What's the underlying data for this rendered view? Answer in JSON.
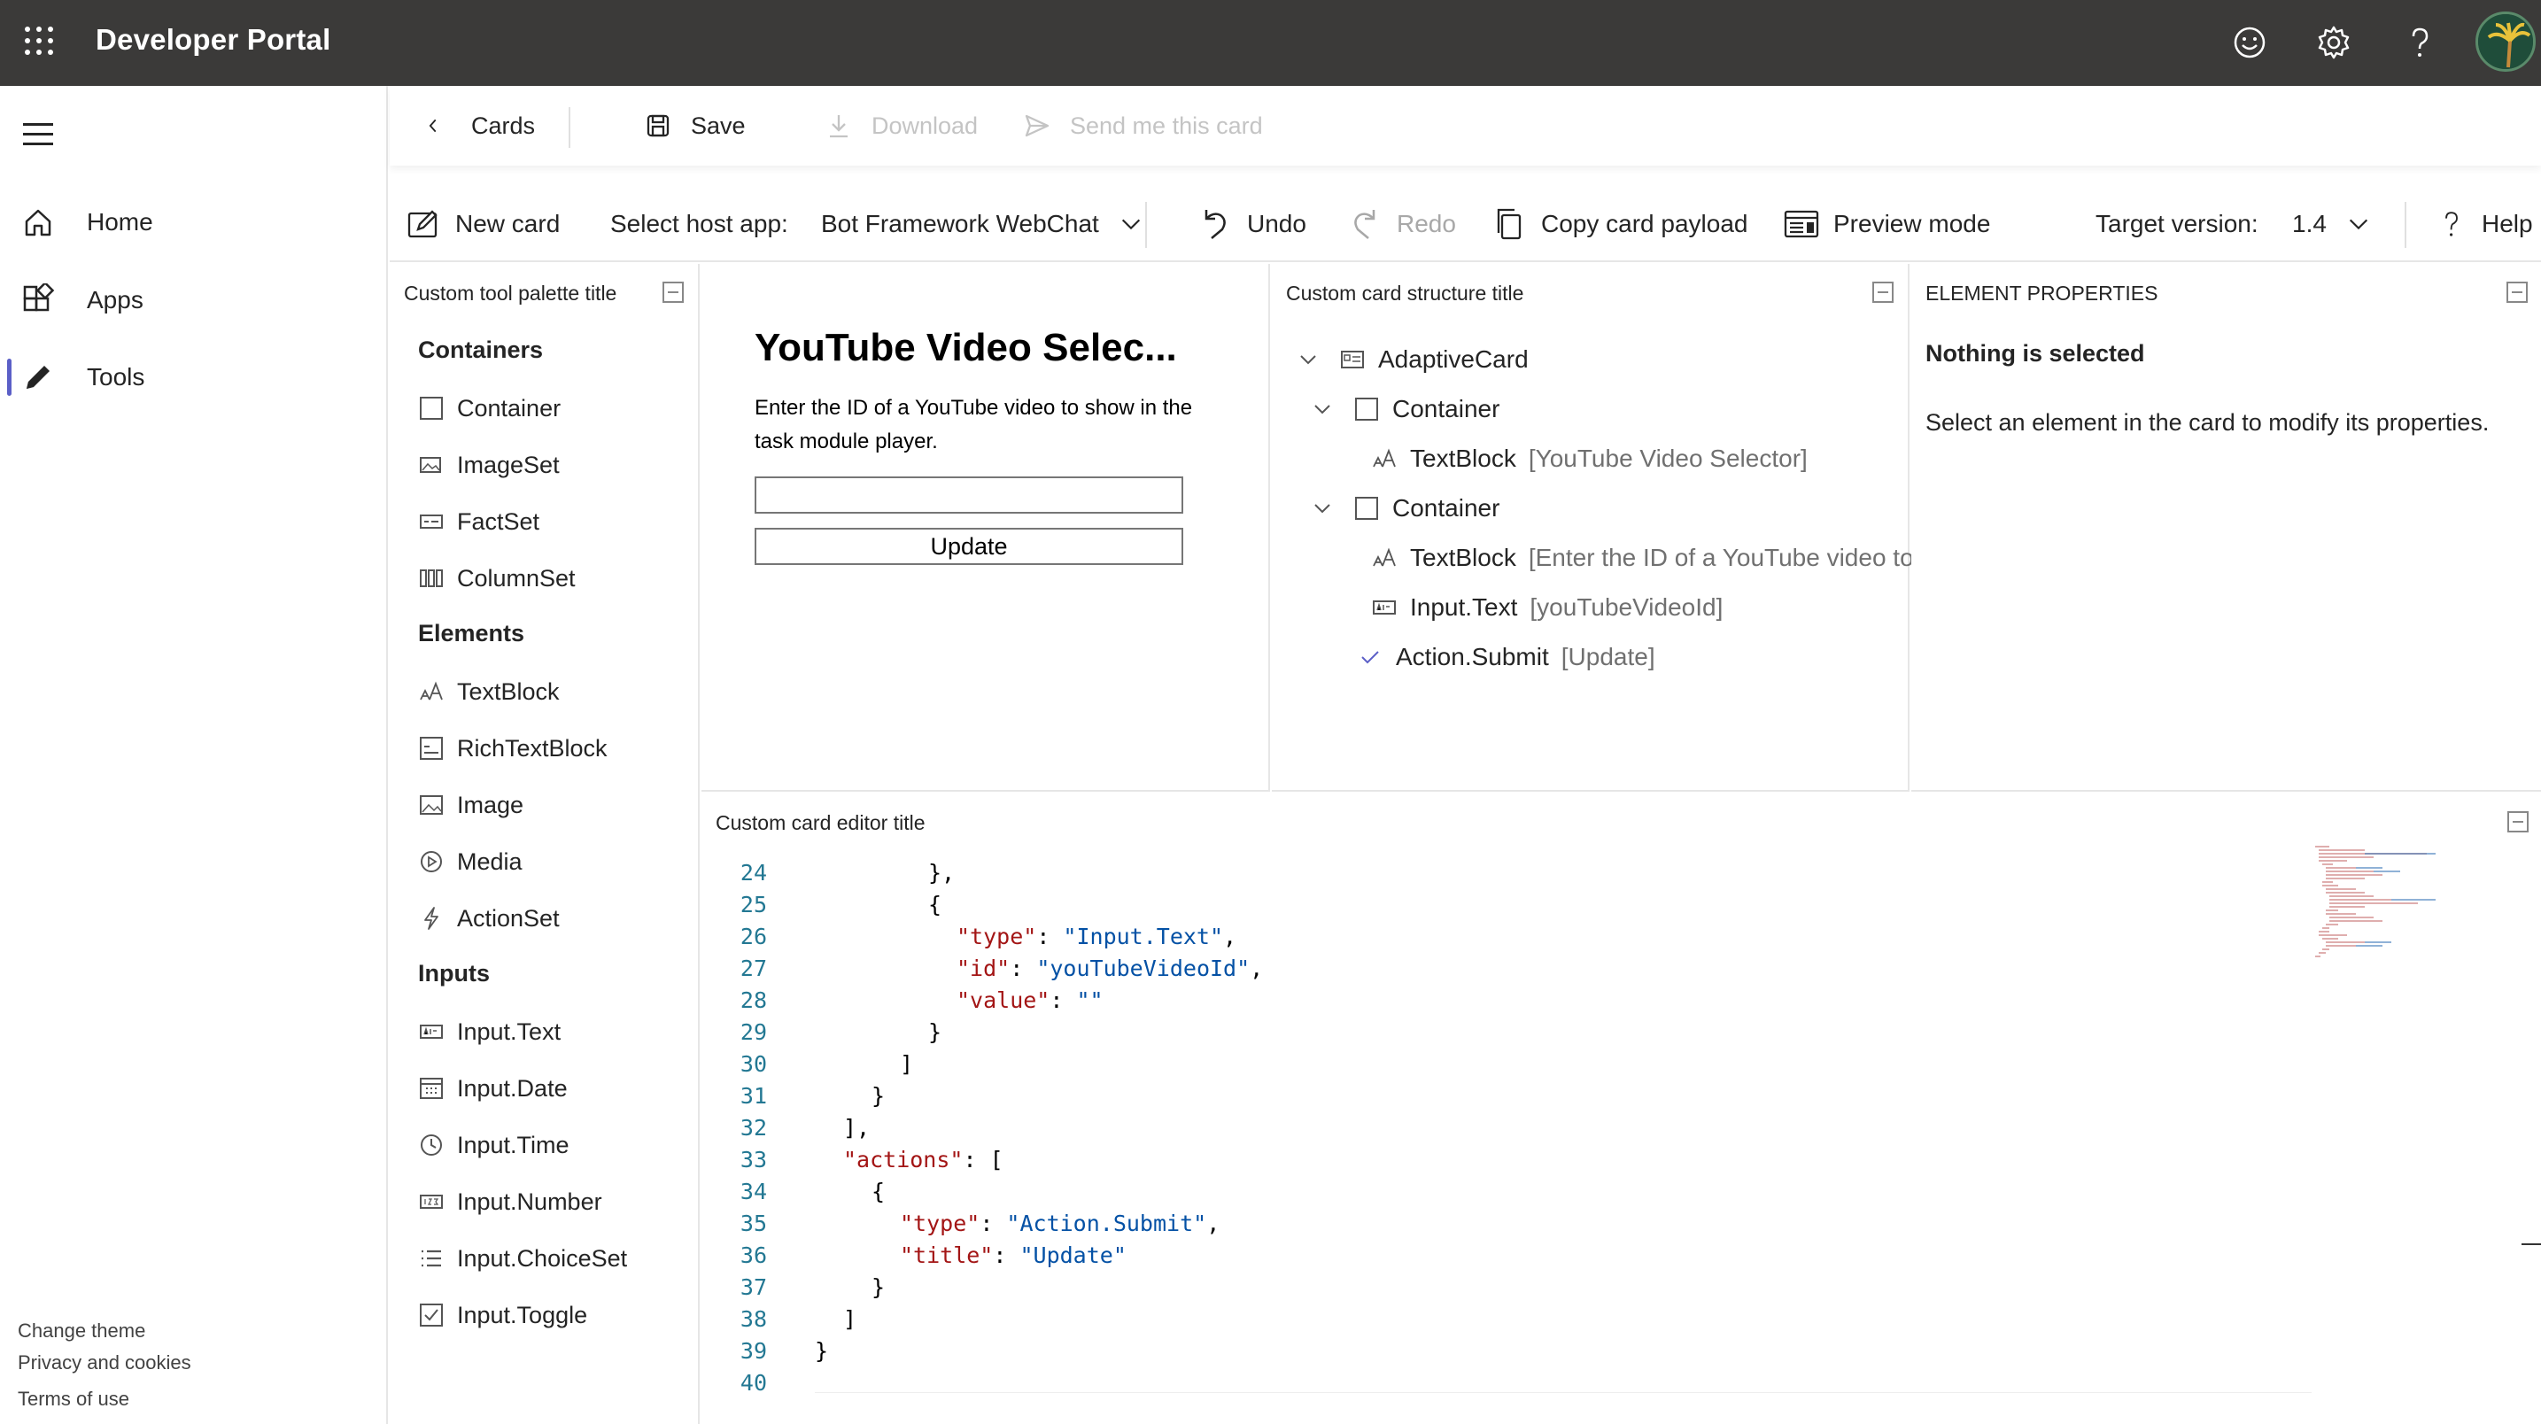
{
  "header": {
    "app_title": "Developer Portal",
    "icons": [
      "waffle-icon",
      "smiley-icon",
      "gear-icon",
      "help-icon",
      "avatar"
    ]
  },
  "sidebar": {
    "items": [
      {
        "label": "Home",
        "icon": "home-icon"
      },
      {
        "label": "Apps",
        "icon": "apps-icon"
      },
      {
        "label": "Tools",
        "icon": "pencil-icon",
        "active": true
      }
    ],
    "footer": [
      "Change theme",
      "Privacy and cookies",
      "Terms of use"
    ]
  },
  "toolbar": {
    "back_label": "Cards",
    "save_label": "Save",
    "download_label": "Download",
    "send_label": "Send me this card"
  },
  "designer_toolbar": {
    "new_card": "New card",
    "host_app_label": "Select host app:",
    "host_app_value": "Bot Framework WebChat",
    "undo": "Undo",
    "redo": "Redo",
    "copy_payload": "Copy card payload",
    "preview_mode": "Preview mode",
    "target_version_label": "Target version:",
    "target_version_value": "1.4",
    "help": "Help"
  },
  "palette": {
    "title": "Custom tool palette title",
    "groups": [
      {
        "label": "Containers",
        "items": [
          "Container",
          "ImageSet",
          "FactSet",
          "ColumnSet"
        ]
      },
      {
        "label": "Elements",
        "items": [
          "TextBlock",
          "RichTextBlock",
          "Image",
          "Media",
          "ActionSet"
        ]
      },
      {
        "label": "Inputs",
        "items": [
          "Input.Text",
          "Input.Date",
          "Input.Time",
          "Input.Number",
          "Input.ChoiceSet",
          "Input.Toggle"
        ]
      }
    ]
  },
  "preview": {
    "card_title": "YouTube Video Selec...",
    "card_body": "Enter the ID of a YouTube video to show in the task module player.",
    "input_value": "",
    "button_label": "Update"
  },
  "structure": {
    "title": "Custom card structure title",
    "rows": [
      {
        "type": "AdaptiveCard",
        "sub": ""
      },
      {
        "type": "Container",
        "sub": ""
      },
      {
        "type": "TextBlock",
        "sub": "[YouTube Video Selector]"
      },
      {
        "type": "Container",
        "sub": ""
      },
      {
        "type": "TextBlock",
        "sub": "[Enter the ID of a YouTube video to"
      },
      {
        "type": "Input.Text",
        "sub": "[youTubeVideoId]"
      },
      {
        "type": "Action.Submit",
        "sub": "[Update]"
      }
    ]
  },
  "properties": {
    "title": "ELEMENT PROPERTIES",
    "heading": "Nothing is selected",
    "text": "Select an element in the card to modify its properties."
  },
  "editor": {
    "title": "Custom card editor title",
    "lines": [
      {
        "n": "24",
        "indent": 4,
        "tokens": [
          [
            "p",
            "},"
          ]
        ]
      },
      {
        "n": "25",
        "indent": 4,
        "tokens": [
          [
            "p",
            "{"
          ]
        ]
      },
      {
        "n": "26",
        "indent": 5,
        "tokens": [
          [
            "k",
            "\"type\""
          ],
          [
            "p",
            ": "
          ],
          [
            "s",
            "\"Input.Text\""
          ],
          [
            "p",
            ","
          ]
        ]
      },
      {
        "n": "27",
        "indent": 5,
        "tokens": [
          [
            "k",
            "\"id\""
          ],
          [
            "p",
            ": "
          ],
          [
            "s",
            "\"youTubeVideoId\""
          ],
          [
            "p",
            ","
          ]
        ]
      },
      {
        "n": "28",
        "indent": 5,
        "tokens": [
          [
            "k",
            "\"value\""
          ],
          [
            "p",
            ": "
          ],
          [
            "s",
            "\"\""
          ]
        ]
      },
      {
        "n": "29",
        "indent": 4,
        "tokens": [
          [
            "p",
            "}"
          ]
        ]
      },
      {
        "n": "30",
        "indent": 3,
        "tokens": [
          [
            "p",
            "]"
          ]
        ]
      },
      {
        "n": "31",
        "indent": 2,
        "tokens": [
          [
            "p",
            "}"
          ]
        ]
      },
      {
        "n": "32",
        "indent": 1,
        "tokens": [
          [
            "p",
            "],"
          ]
        ]
      },
      {
        "n": "33",
        "indent": 1,
        "tokens": [
          [
            "k",
            "\"actions\""
          ],
          [
            "p",
            ": ["
          ]
        ]
      },
      {
        "n": "34",
        "indent": 2,
        "tokens": [
          [
            "p",
            "{"
          ]
        ]
      },
      {
        "n": "35",
        "indent": 3,
        "tokens": [
          [
            "k",
            "\"type\""
          ],
          [
            "p",
            ": "
          ],
          [
            "s",
            "\"Action.Submit\""
          ],
          [
            "p",
            ","
          ]
        ]
      },
      {
        "n": "36",
        "indent": 3,
        "tokens": [
          [
            "k",
            "\"title\""
          ],
          [
            "p",
            ": "
          ],
          [
            "s",
            "\"Update\""
          ]
        ]
      },
      {
        "n": "37",
        "indent": 2,
        "tokens": [
          [
            "p",
            "}"
          ]
        ]
      },
      {
        "n": "38",
        "indent": 1,
        "tokens": [
          [
            "p",
            "]"
          ]
        ]
      },
      {
        "n": "39",
        "indent": 0,
        "tokens": [
          [
            "p",
            "}"
          ]
        ]
      },
      {
        "n": "40",
        "indent": 0,
        "tokens": []
      }
    ]
  },
  "colors": {
    "topbar": "#3b3a39",
    "accent": "#5b5fc7",
    "json_key": "#a31515",
    "json_string": "#0451a5",
    "line_number": "#237893"
  }
}
